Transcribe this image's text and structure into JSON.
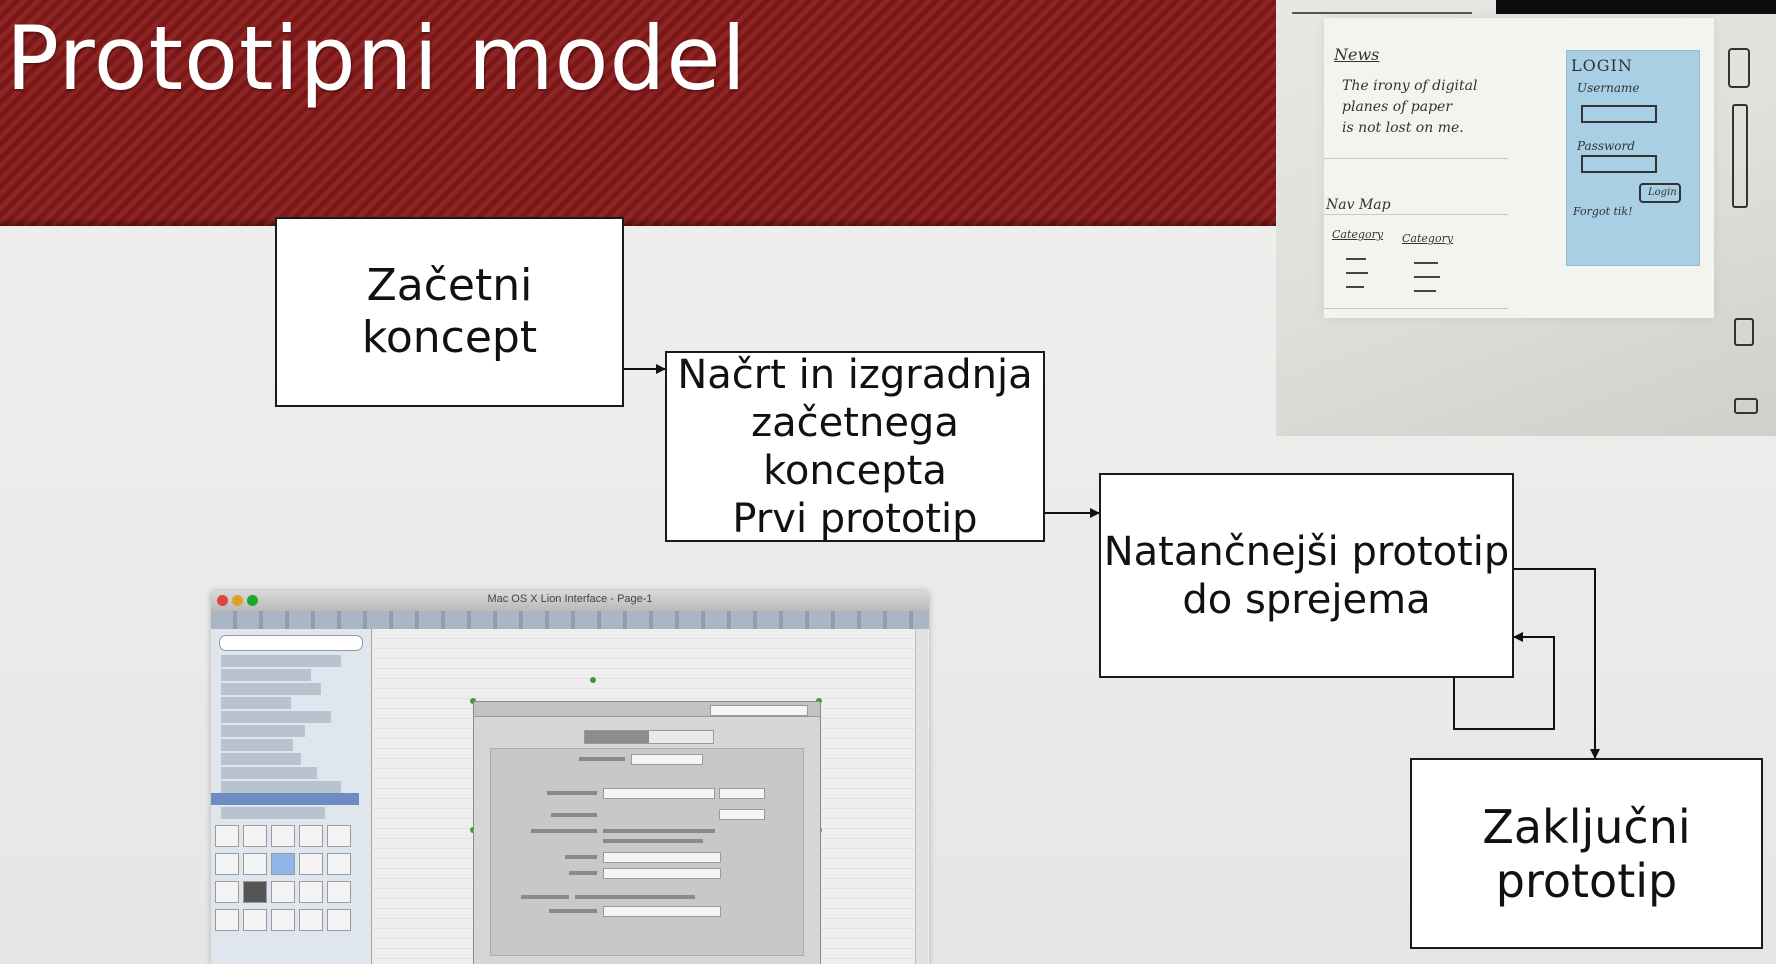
{
  "slide": {
    "title": "Prototipni model"
  },
  "diagram": {
    "steps": [
      "Začetni koncept",
      "Načrt in izgradnja\nzačetnega koncepta\nPrvi prototip",
      "Natančnejši prototip\ndo sprejema",
      "Zaključni\nprototip"
    ]
  },
  "colors": {
    "header_red": "#7a1717",
    "header_stripe": "#8e2424",
    "box_border": "#1a1a1a",
    "sketch_login_panel": "#a9cfe4"
  },
  "sketch_photo": {
    "news_heading": "News",
    "news_text": "The irony of digital\nplanes of paper\nis not lost on me.",
    "nav_heading": "Nav Map",
    "col1": "Category",
    "col2": "Category",
    "login_heading": "LOGIN",
    "username_label": "Username",
    "password_label": "Password",
    "button_label": "Login",
    "forgot_label": "Forgot tik!"
  },
  "app_screenshot": {
    "window_title": "Mac OS X Lion Interface - Page-1"
  }
}
